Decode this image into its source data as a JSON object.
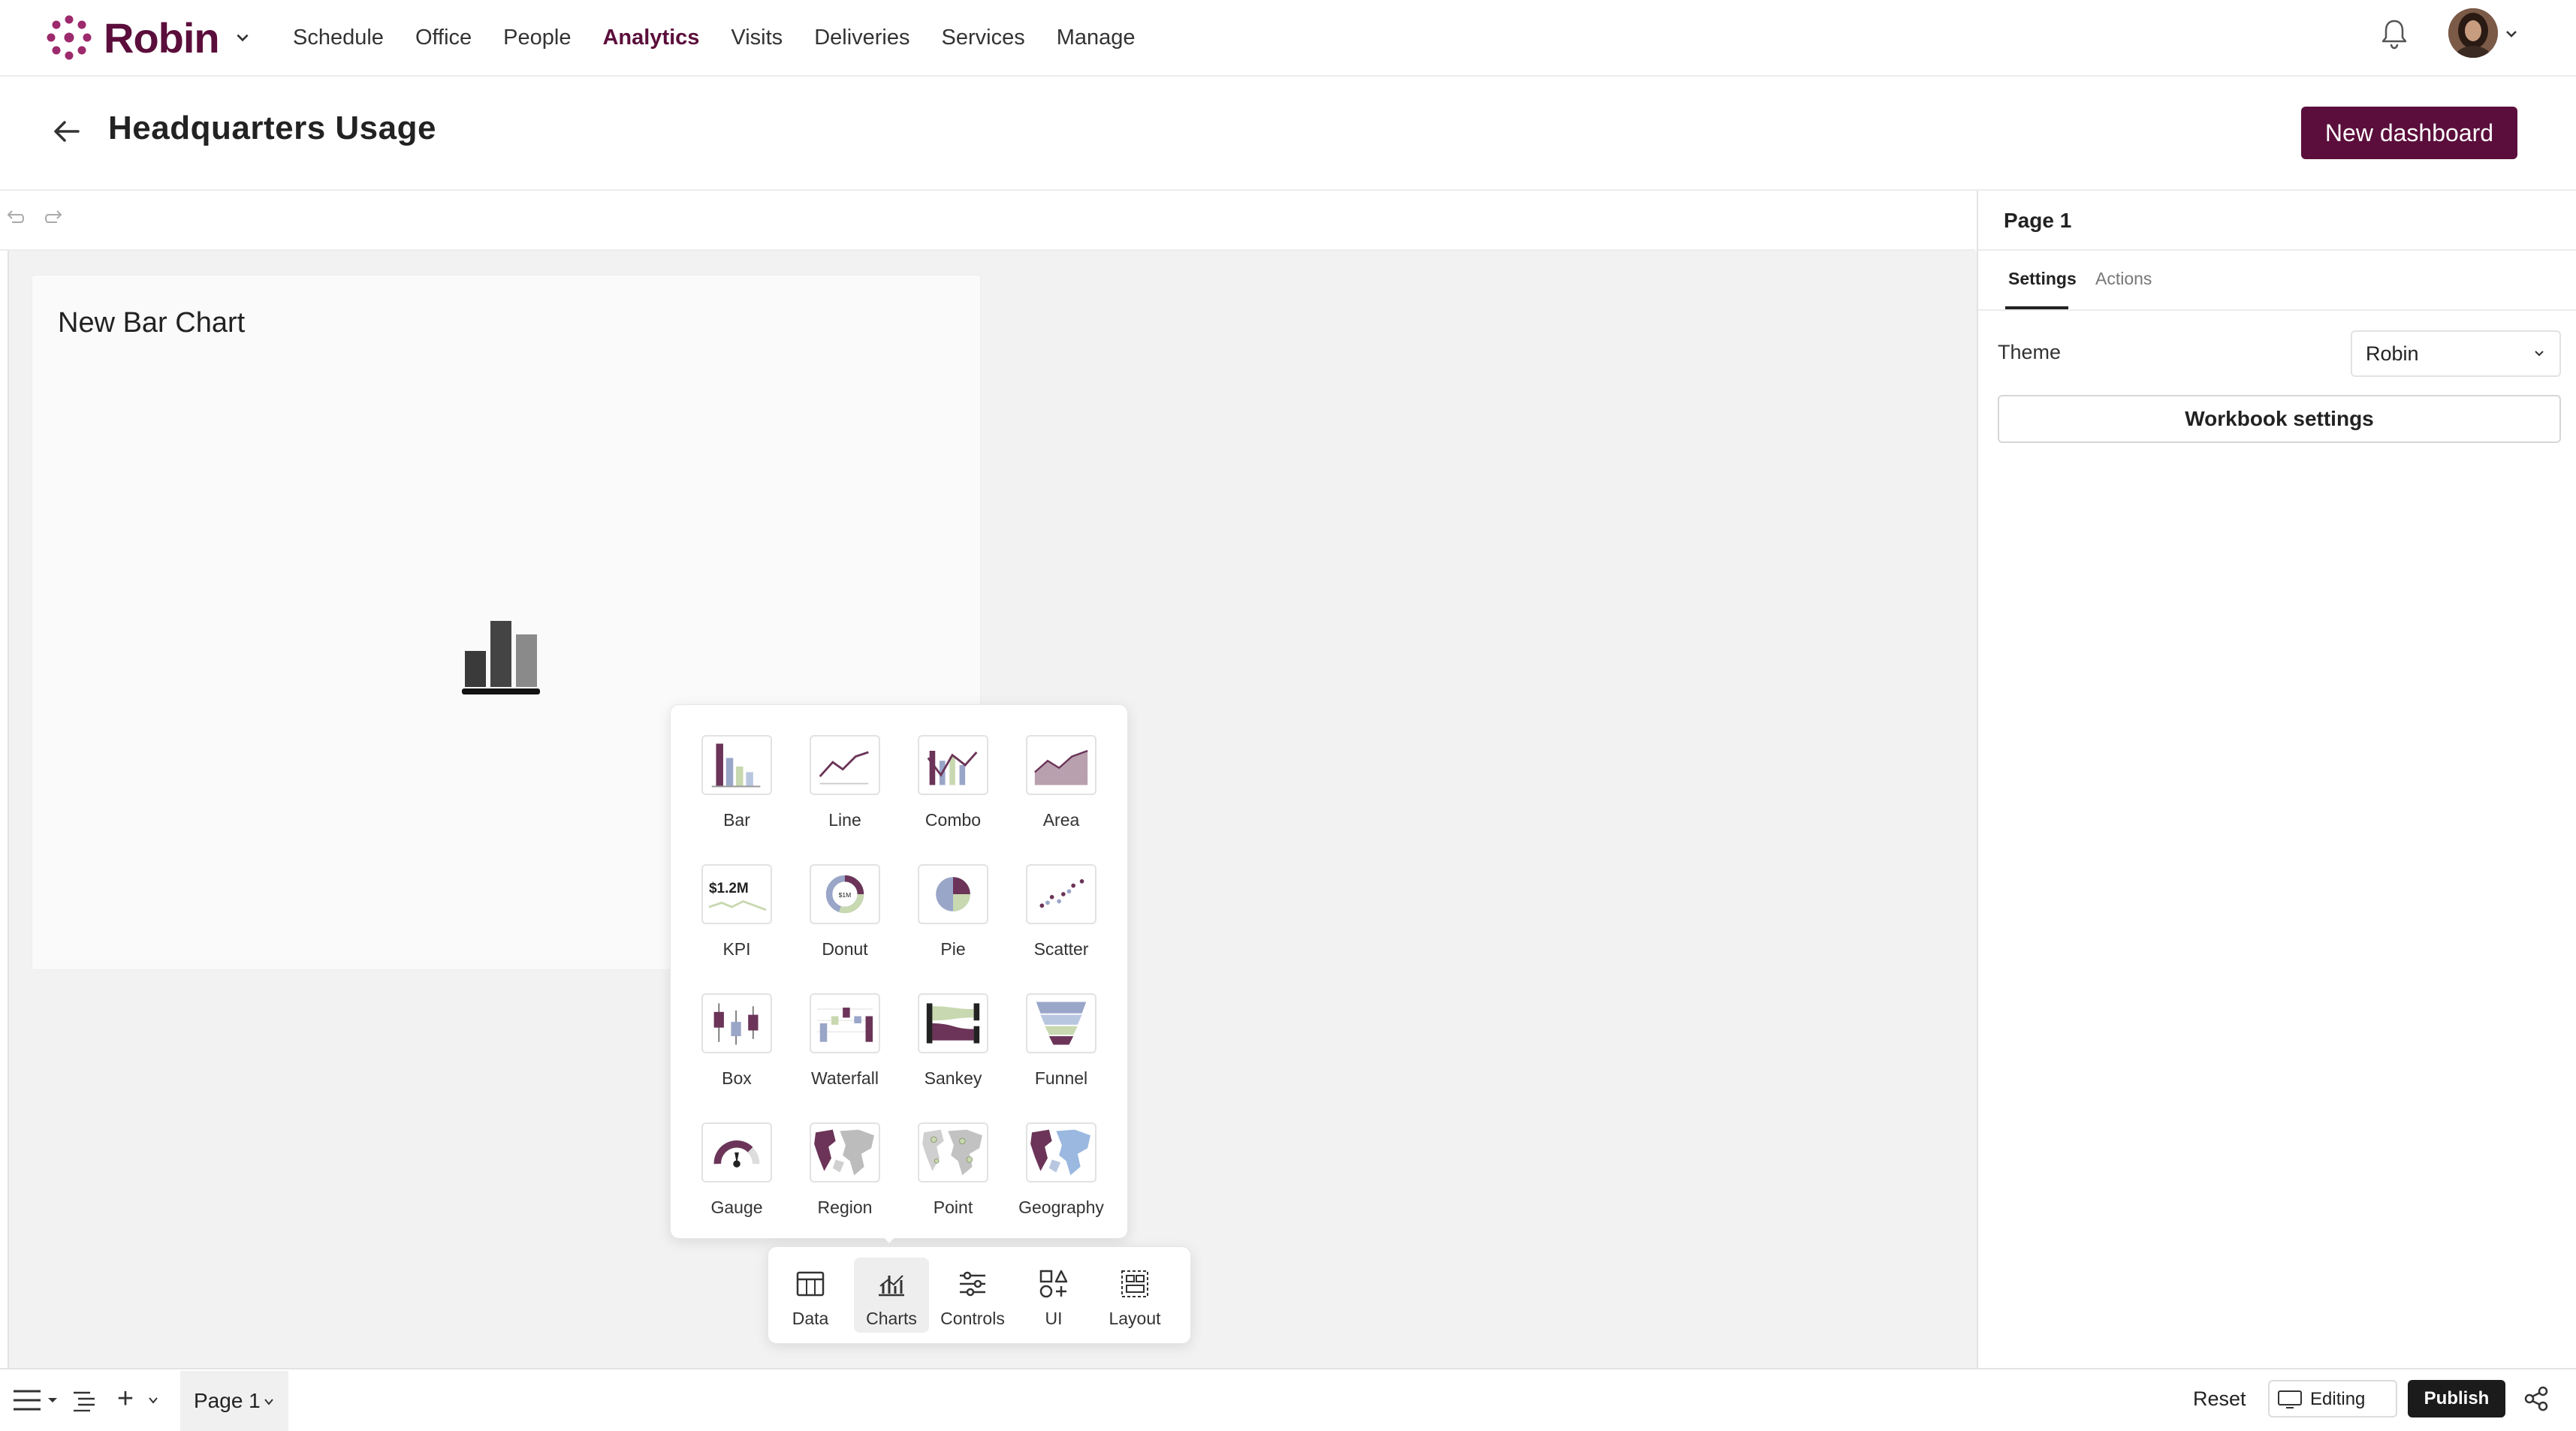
{
  "app": {
    "logo_text": "Robin",
    "brand_color": "#5b0e3b"
  },
  "nav": {
    "items": [
      {
        "label": "Schedule",
        "active": false
      },
      {
        "label": "Office",
        "active": false
      },
      {
        "label": "People",
        "active": false
      },
      {
        "label": "Analytics",
        "active": true
      },
      {
        "label": "Visits",
        "active": false
      },
      {
        "label": "Deliveries",
        "active": false
      },
      {
        "label": "Services",
        "active": false
      },
      {
        "label": "Manage",
        "active": false
      }
    ],
    "icons": [
      "bell-icon",
      "avatar",
      "chevron-down-icon"
    ]
  },
  "header": {
    "title": "Headquarters Usage",
    "new_dashboard_label": "New dashboard"
  },
  "canvas": {
    "chart_card_title": "New Bar Chart"
  },
  "chart_picker": {
    "tiles": [
      {
        "label": "Bar",
        "icon": "bar-chart-icon"
      },
      {
        "label": "Line",
        "icon": "line-chart-icon"
      },
      {
        "label": "Combo",
        "icon": "combo-chart-icon"
      },
      {
        "label": "Area",
        "icon": "area-chart-icon"
      },
      {
        "label": "KPI",
        "icon": "kpi-chart-icon",
        "thumb_text": "$1.2M"
      },
      {
        "label": "Donut",
        "icon": "donut-chart-icon",
        "thumb_text": "$1M"
      },
      {
        "label": "Pie",
        "icon": "pie-chart-icon"
      },
      {
        "label": "Scatter",
        "icon": "scatter-chart-icon"
      },
      {
        "label": "Box",
        "icon": "box-plot-icon"
      },
      {
        "label": "Waterfall",
        "icon": "waterfall-chart-icon"
      },
      {
        "label": "Sankey",
        "icon": "sankey-chart-icon"
      },
      {
        "label": "Funnel",
        "icon": "funnel-chart-icon"
      },
      {
        "label": "Gauge",
        "icon": "gauge-chart-icon"
      },
      {
        "label": "Region",
        "icon": "region-map-icon"
      },
      {
        "label": "Point",
        "icon": "point-map-icon"
      },
      {
        "label": "Geography",
        "icon": "geography-map-icon"
      }
    ]
  },
  "dock": {
    "items": [
      {
        "label": "Data",
        "icon": "table-icon",
        "active": false
      },
      {
        "label": "Charts",
        "icon": "charts-icon",
        "active": true
      },
      {
        "label": "Controls",
        "icon": "sliders-icon",
        "active": false
      },
      {
        "label": "UI",
        "icon": "shapes-icon",
        "active": false
      },
      {
        "label": "Layout",
        "icon": "layout-icon",
        "active": false
      }
    ]
  },
  "right_panel": {
    "page_title": "Page 1",
    "tabs": [
      {
        "label": "Settings",
        "active": true
      },
      {
        "label": "Actions",
        "active": false
      }
    ],
    "theme_label": "Theme",
    "theme_value": "Robin",
    "workbook_settings_label": "Workbook settings"
  },
  "footer": {
    "page_tab_label": "Page 1",
    "add_label": "+",
    "reset_label": "Reset",
    "editing_label": "Editing",
    "publish_label": "Publish"
  }
}
